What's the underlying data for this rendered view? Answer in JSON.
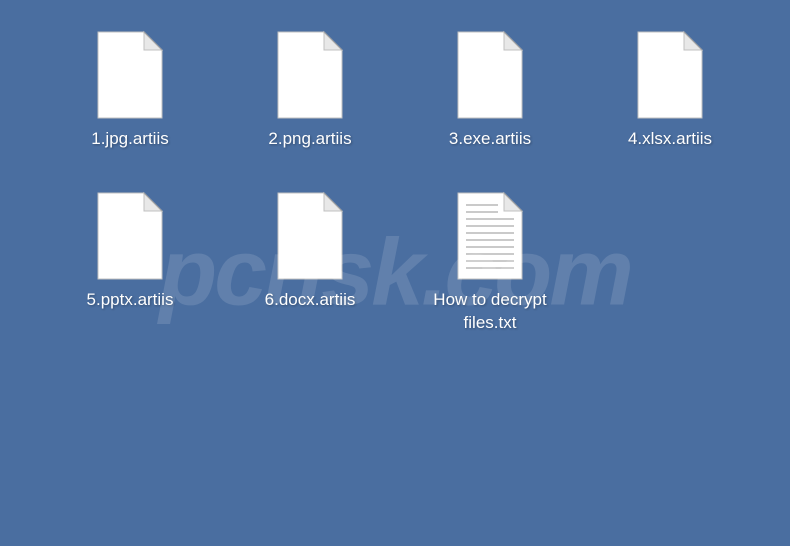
{
  "desktop": {
    "files": [
      {
        "name": "1.jpg.artiis",
        "type": "blank"
      },
      {
        "name": "2.png.artiis",
        "type": "blank"
      },
      {
        "name": "3.exe.artiis",
        "type": "blank"
      },
      {
        "name": "4.xlsx.artiis",
        "type": "blank"
      },
      {
        "name": "5.pptx.artiis",
        "type": "blank"
      },
      {
        "name": "6.docx.artiis",
        "type": "blank"
      },
      {
        "name": "How to decrypt files.txt",
        "type": "text"
      }
    ]
  },
  "watermark": "pcrisk.com"
}
